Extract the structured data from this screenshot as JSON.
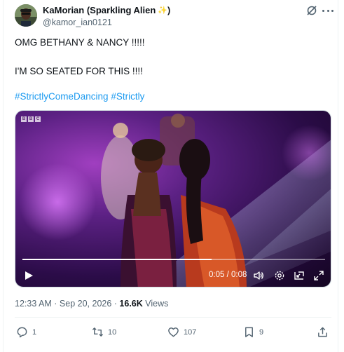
{
  "post": {
    "author_name": "KaMorian (Sparkling Alien",
    "author_name_end": ")",
    "handle": "@kamor_ian0121",
    "line1": "OMG BETHANY & NANCY !!!!!",
    "line2": "I'M SO SEATED FOR THIS !!!!",
    "hashtags": [
      "#StrictlyComeDancing",
      "#Strictly"
    ],
    "timestamp": "12:33 AM · Sep 20, 2026 ·",
    "views_count": "16.6K",
    "views_label": "Views"
  },
  "video": {
    "channel_logo": [
      "B",
      "B",
      "C"
    ],
    "current_time": "0:05",
    "separator": "/",
    "duration": "0:08",
    "progress": 0.625
  },
  "actions": {
    "replies": "1",
    "reposts": "10",
    "likes": "107",
    "bookmarks": "9"
  },
  "icons": [
    "grok-icon",
    "more-icon",
    "play-icon",
    "volume-icon",
    "settings-icon",
    "pip-icon",
    "fullscreen-icon",
    "reply-icon",
    "repost-icon",
    "like-icon",
    "bookmark-icon",
    "share-icon"
  ],
  "colors": {
    "accent": "#1d9bf0",
    "secondary_text": "#536471",
    "primary_text": "#0f1419"
  }
}
